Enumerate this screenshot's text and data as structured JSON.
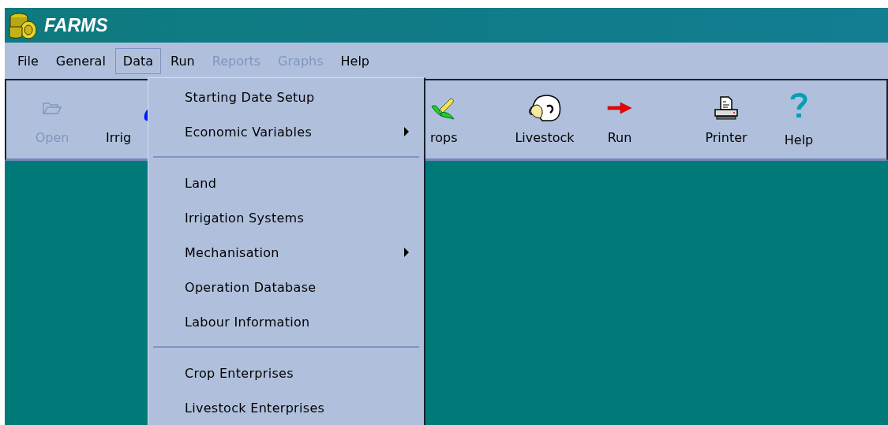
{
  "window": {
    "title": "FARMS"
  },
  "menubar": [
    {
      "label": "File",
      "disabled": false,
      "selected": false
    },
    {
      "label": "General",
      "disabled": false,
      "selected": false
    },
    {
      "label": "Data",
      "disabled": false,
      "selected": true
    },
    {
      "label": "Run",
      "disabled": false,
      "selected": false
    },
    {
      "label": "Reports",
      "disabled": true,
      "selected": false
    },
    {
      "label": "Graphs",
      "disabled": true,
      "selected": false
    },
    {
      "label": "Help",
      "disabled": false,
      "selected": false
    }
  ],
  "toolbar": [
    {
      "label": "Open",
      "disabled": true
    },
    {
      "label": "Irrig",
      "disabled": false
    },
    {
      "label": "rops",
      "disabled": false
    },
    {
      "label": "Livestock",
      "disabled": false
    },
    {
      "label": "Run",
      "disabled": false
    },
    {
      "label": "Printer",
      "disabled": false
    },
    {
      "label": "Help",
      "disabled": false
    }
  ],
  "dropdown": [
    {
      "kind": "item",
      "label": "Starting Date Setup",
      "submenu": false
    },
    {
      "kind": "item",
      "label": "Economic Variables",
      "submenu": true
    },
    {
      "kind": "separator"
    },
    {
      "kind": "item",
      "label": "Land",
      "submenu": false
    },
    {
      "kind": "item",
      "label": "Irrigation Systems",
      "submenu": false
    },
    {
      "kind": "item",
      "label": "Mechanisation",
      "submenu": true
    },
    {
      "kind": "item",
      "label": "Operation Database",
      "submenu": false
    },
    {
      "kind": "item",
      "label": "Labour Information",
      "submenu": false
    },
    {
      "kind": "separator"
    },
    {
      "kind": "item",
      "label": "Crop Enterprises",
      "submenu": false
    },
    {
      "kind": "item",
      "label": "Livestock Enterprises",
      "submenu": false
    }
  ]
}
